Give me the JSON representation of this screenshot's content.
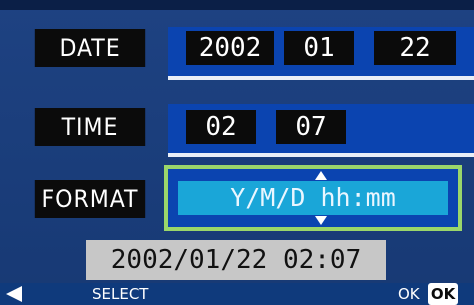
{
  "settings": {
    "date": {
      "label": "DATE",
      "year": "2002",
      "month": "01",
      "day": "22"
    },
    "time": {
      "label": "TIME",
      "hour": "02",
      "minute": "07"
    },
    "format": {
      "label": "FORMAT",
      "value": "Y/M/D hh:mm"
    }
  },
  "preview": {
    "text": "2002/01/22 02:07"
  },
  "footer": {
    "select_label": "SELECT",
    "ok_text": "OK",
    "ok_button": "OK"
  },
  "colors": {
    "background": "#1a3e7a",
    "row_highlight": "#0b44b0",
    "selected_frame": "#9bd66a",
    "selected_field": "#1aa6d8",
    "preview_bg": "#c7c7c7"
  }
}
